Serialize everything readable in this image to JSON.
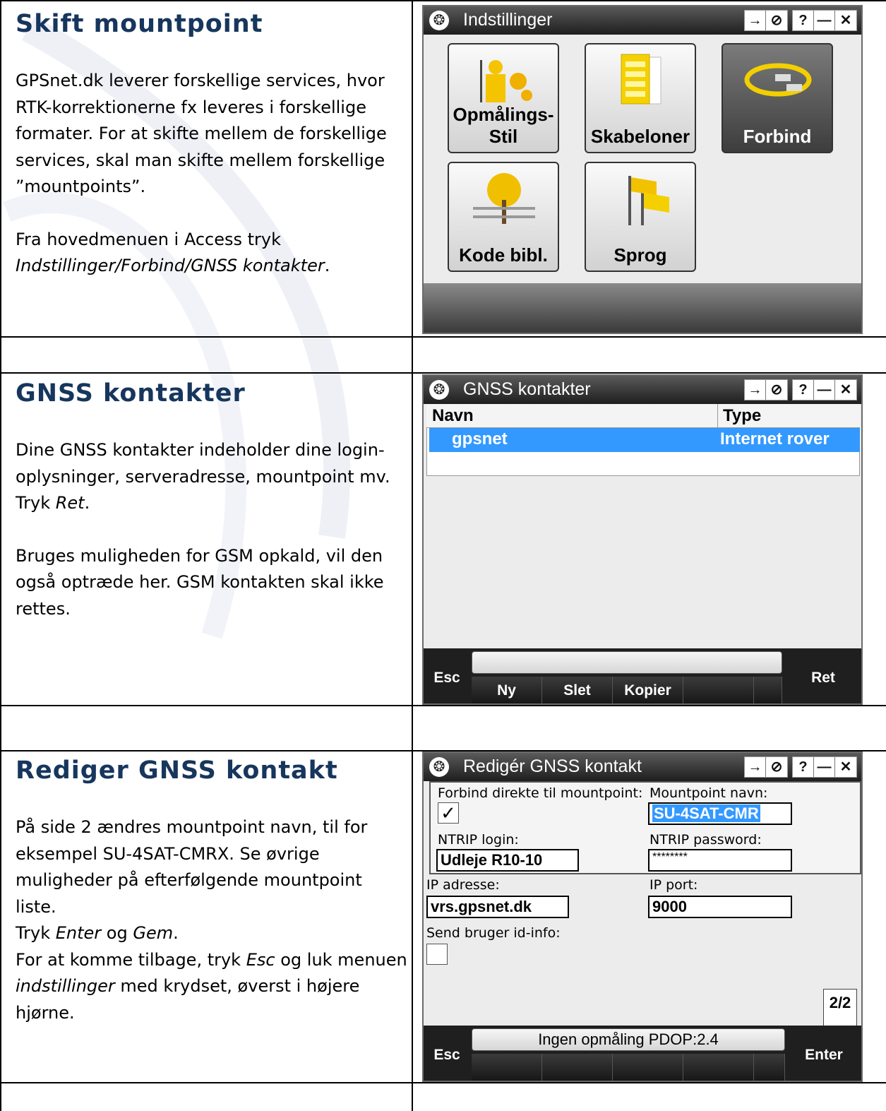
{
  "sections": [
    {
      "heading": "Skift mountpoint",
      "para1": "GPSnet.dk leverer forskellige services, hvor RTK-korrektionerne fx leveres i forskellige formater. For at skifte mellem de forskellige services, skal man skifte mellem forskellige ”mountpoints”.",
      "para2_prefix": "Fra hovedmenuen i Access tryk ",
      "para2_em": "Indstillinger/Forbind/GNSS kontakter",
      "para2_suffix": "."
    },
    {
      "heading": "GNSS kontakter",
      "para1": "Dine GNSS kontakter indeholder dine login-oplysninger, serveradresse, mountpoint mv.",
      "para1b_prefix": "Tryk ",
      "para1b_em": "Ret",
      "para1b_suffix": ".",
      "para2": "Bruges muligheden for GSM opkald, vil den også optræde her. GSM kontakten skal ikke rettes."
    },
    {
      "heading": "Rediger GNSS kontakt",
      "para1": "På side 2 ændres mountpoint navn, til for eksempel SU-4SAT-CMRX. Se øvrige muligheder på efterfølgende mountpoint liste.",
      "line2_prefix": "Tryk ",
      "line2_em1": "Enter",
      "line2_mid": " og ",
      "line2_em2": "Gem",
      "line2_suffix": ".",
      "line3_prefix": "For at komme tilbage, tryk ",
      "line3_em1": "Esc",
      "line3_mid": " og luk menuen ",
      "line3_em2": "indstillinger",
      "line3_suffix": " med krydset, øverst i højere hjørne."
    }
  ],
  "titlebar_buttons": [
    "→",
    "⊘",
    "?",
    "—",
    "✕"
  ],
  "screen1": {
    "title": "Indstillinger",
    "tiles": [
      {
        "line1": "Opmålings-",
        "line2": "Stil"
      },
      {
        "line1": "",
        "line2": "Skabeloner"
      },
      {
        "line1": "",
        "line2": "Forbind"
      },
      {
        "line1": "",
        "line2": "Kode bibl."
      },
      {
        "line1": "",
        "line2": "Sprog"
      }
    ]
  },
  "screen2": {
    "title": "GNSS kontakter",
    "columns": [
      "Navn",
      "Type"
    ],
    "rows": [
      {
        "name": "gpsnet",
        "type": "Internet rover"
      }
    ],
    "softkeys": {
      "esc": "Esc",
      "ny": "Ny",
      "slet": "Slet",
      "kopier": "Kopier",
      "ret": "Ret"
    }
  },
  "screen3": {
    "title": "Redigér GNSS kontakt",
    "labels": {
      "direct": "Forbind direkte til mountpoint:",
      "mountpoint": "Mountpoint navn:",
      "login": "NTRIP login:",
      "password": "NTRIP password:",
      "ip": "IP adresse:",
      "port": "IP port:",
      "send_id": "Send bruger id-info:"
    },
    "values": {
      "direct_check": "✓",
      "mountpoint": "SU-4SAT-CMR",
      "login": "Udleje R10-10",
      "password": "********",
      "ip": "vrs.gpsnet.dk",
      "port": "9000"
    },
    "page": "2/2",
    "status": "Ingen opmåling  PDOP:2.4",
    "softkeys": {
      "esc": "Esc",
      "enter": "Enter"
    }
  }
}
